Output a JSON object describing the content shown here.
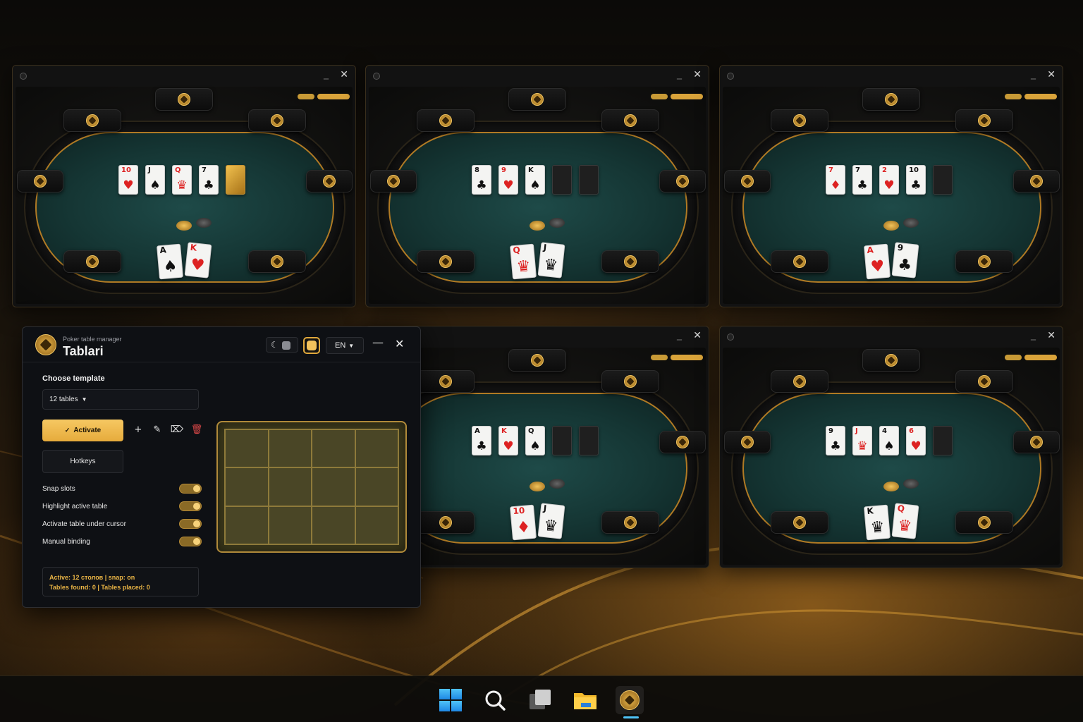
{
  "tables": [
    {
      "board": [
        {
          "r": "10",
          "s": "♥",
          "c": "red"
        },
        {
          "r": "J",
          "s": "♠",
          "c": "blk"
        },
        {
          "r": "Q",
          "s": "♛",
          "c": "red"
        },
        {
          "r": "7",
          "s": "♣",
          "c": "blk"
        },
        {
          "type": "gold"
        }
      ],
      "hole": [
        {
          "r": "A",
          "s": "♠",
          "c": "blk"
        },
        {
          "r": "K",
          "s": "♥",
          "c": "red"
        }
      ]
    },
    {
      "board": [
        {
          "r": "8",
          "s": "♣",
          "c": "blk"
        },
        {
          "r": "9",
          "s": "♥",
          "c": "red"
        },
        {
          "r": "K",
          "s": "♠",
          "c": "blk"
        },
        {
          "type": "back"
        },
        {
          "type": "back"
        }
      ],
      "hole": [
        {
          "r": "Q",
          "s": "♛",
          "c": "red"
        },
        {
          "r": "J",
          "s": "♛",
          "c": "blk"
        }
      ]
    },
    {
      "board": [
        {
          "r": "7",
          "s": "♦",
          "c": "red"
        },
        {
          "r": "7",
          "s": "♣",
          "c": "blk"
        },
        {
          "r": "2",
          "s": "♥",
          "c": "red"
        },
        {
          "r": "10",
          "s": "♣",
          "c": "blk"
        },
        {
          "type": "back"
        }
      ],
      "hole": [
        {
          "r": "A",
          "s": "♥",
          "c": "red"
        },
        {
          "r": "9",
          "s": "♣",
          "c": "blk"
        }
      ]
    },
    {
      "board": [
        {
          "r": "A",
          "s": "♣",
          "c": "blk"
        },
        {
          "r": "K",
          "s": "♥",
          "c": "red"
        },
        {
          "r": "Q",
          "s": "♠",
          "c": "blk"
        },
        {
          "type": "back"
        },
        {
          "type": "back"
        }
      ],
      "hole": [
        {
          "r": "10",
          "s": "♦",
          "c": "red"
        },
        {
          "r": "J",
          "s": "♛",
          "c": "blk"
        }
      ]
    },
    {
      "board": [
        {
          "r": "9",
          "s": "♣",
          "c": "blk"
        },
        {
          "r": "J",
          "s": "♛",
          "c": "red"
        },
        {
          "r": "4",
          "s": "♠",
          "c": "blk"
        },
        {
          "r": "6",
          "s": "♥",
          "c": "red"
        },
        {
          "type": "back"
        }
      ],
      "hole": [
        {
          "r": "K",
          "s": "♛",
          "c": "blk"
        },
        {
          "r": "Q",
          "s": "♛",
          "c": "red"
        }
      ]
    }
  ],
  "manager": {
    "subtitle": "Poker table manager",
    "title": "Tablari",
    "theme_icon": "moon-icon",
    "language": "EN",
    "minimize_glyph": "—",
    "close_glyph": "✕",
    "template_label": "Choose template",
    "template_value": "12 tables",
    "activate_label": "Activate",
    "hotkeys_label": "Hotkeys",
    "options": [
      {
        "label": "Snap slots",
        "on": true
      },
      {
        "label": "Highlight active table",
        "on": true
      },
      {
        "label": "Activate table under cursor",
        "on": true
      },
      {
        "label": "Manual binding",
        "on": true
      }
    ],
    "status_line1": "Active: 12 столов  |  snap: on",
    "status_line2": "Tables found: 0  |  Tables placed: 0",
    "grid": {
      "cols": 4,
      "rows": 3
    },
    "accent_color": "#f2c25c"
  },
  "taskbar": {
    "items": [
      "start-icon",
      "search-icon",
      "task-view-icon",
      "file-explorer-icon",
      "tablari-icon"
    ]
  }
}
